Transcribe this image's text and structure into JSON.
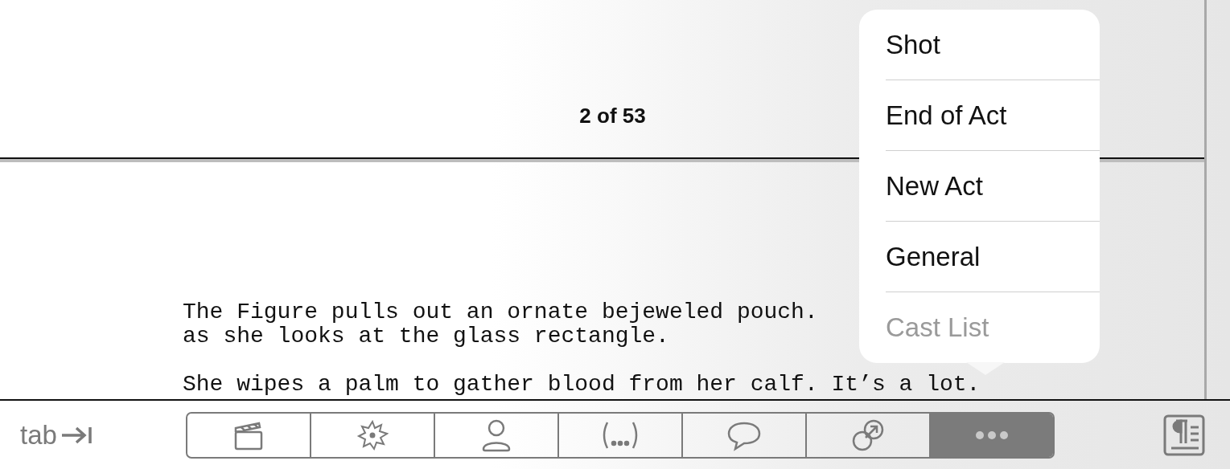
{
  "header": {
    "page_indicator": "2 of 53"
  },
  "script_paragraphs": [
    [
      "The Figure pulls out an ornate bejeweled pouch.",
      "as she looks at the glass rectangle."
    ],
    [
      "She wipes a palm to gather blood from her calf. It’s a lot."
    ]
  ],
  "element_menu": {
    "items": [
      {
        "label": "Shot",
        "disabled": false
      },
      {
        "label": "End of Act",
        "disabled": false
      },
      {
        "label": "New Act",
        "disabled": false
      },
      {
        "label": "General",
        "disabled": false
      },
      {
        "label": "Cast List",
        "disabled": true
      }
    ]
  },
  "toolbar": {
    "tab_key": "tab",
    "segments": [
      {
        "kind": "clapper",
        "selected": false
      },
      {
        "kind": "burst",
        "selected": false
      },
      {
        "kind": "person",
        "selected": false
      },
      {
        "kind": "parenthetical",
        "selected": false
      },
      {
        "kind": "speech",
        "selected": false
      },
      {
        "kind": "link",
        "selected": false
      },
      {
        "kind": "more",
        "selected": true
      }
    ]
  }
}
